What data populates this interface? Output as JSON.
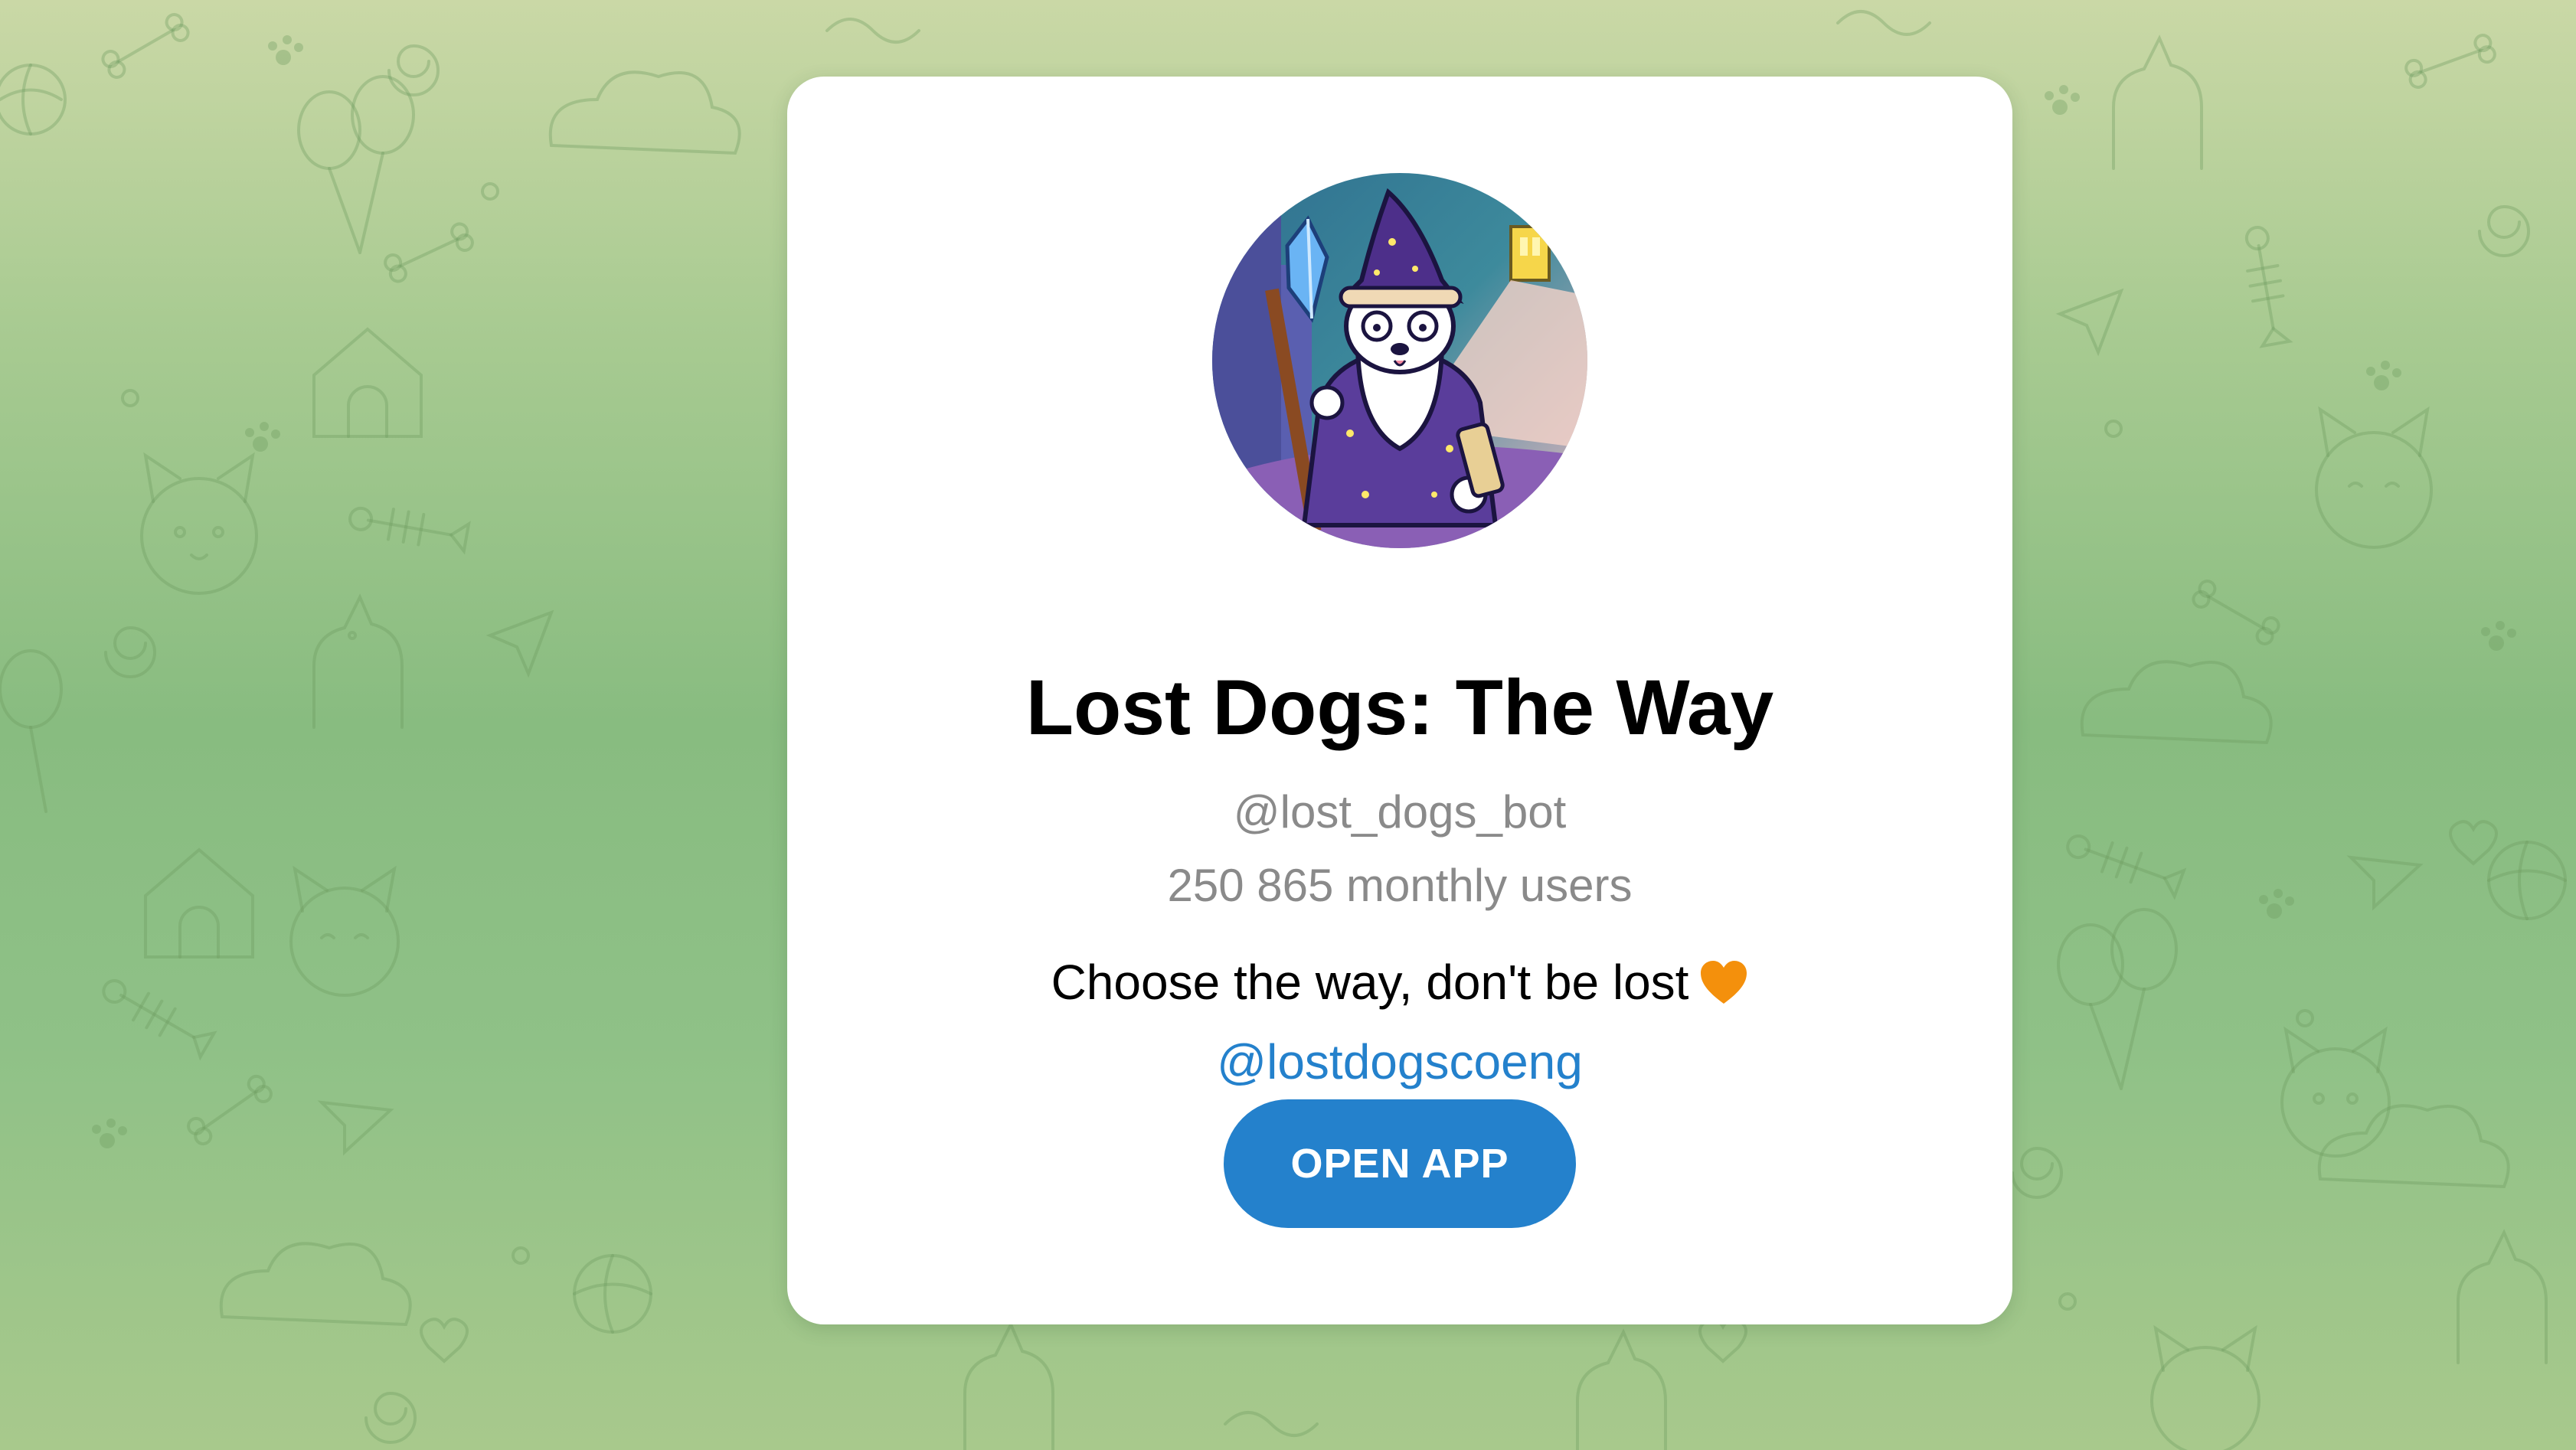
{
  "bot": {
    "title": "Lost Dogs: The Way",
    "username": "@lost_dogs_bot",
    "monthly_users": "250 865 monthly users",
    "description": "Choose the way, don't be lost",
    "description_emoji": "orange-heart-icon",
    "channel_link": "@lostdogscoeng"
  },
  "actions": {
    "open_app_label": "OPEN APP"
  },
  "avatar": {
    "icon": "wizard-dog-avatar"
  },
  "colors": {
    "accent": "#2481cc",
    "background_top": "#cad8a6",
    "background_mid": "#88bc80",
    "muted_text": "#8a8a8a",
    "heart": "#f4900c"
  }
}
